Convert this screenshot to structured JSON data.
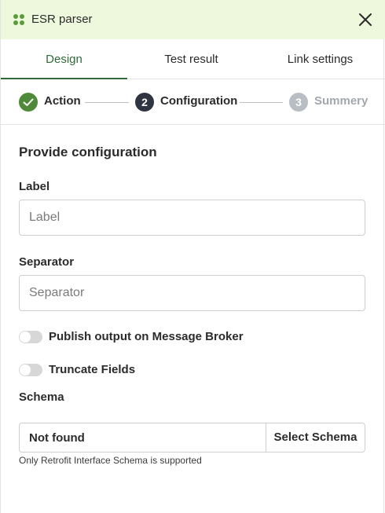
{
  "header": {
    "title": "ESR parser",
    "accent": "#5a9c3c",
    "background": "#eef8dc"
  },
  "tabs": [
    {
      "label": "Design",
      "active": true
    },
    {
      "label": "Test result",
      "active": false
    },
    {
      "label": "Link settings",
      "active": false
    }
  ],
  "stepper": {
    "steps": [
      {
        "number": "1",
        "label": "Action",
        "state": "completed",
        "icon": "check-icon"
      },
      {
        "number": "2",
        "label": "Configuration",
        "state": "current"
      },
      {
        "number": "3",
        "label": "Summery",
        "state": "upcoming"
      }
    ]
  },
  "form": {
    "section_title": "Provide configuration",
    "label_field": {
      "label": "Label",
      "placeholder": "Label",
      "value": ""
    },
    "separator_field": {
      "label": "Separator",
      "placeholder": "Separator",
      "value": ""
    },
    "toggles": [
      {
        "label": "Publish output on Message Broker",
        "on": false
      },
      {
        "label": "Truncate Fields",
        "on": false
      }
    ],
    "schema": {
      "label": "Schema",
      "value": "Not found",
      "button_label": "Select Schema",
      "hint": "Only Retrofit Interface Schema is supported"
    }
  },
  "colors": {
    "tab_active": "#2f6b3a",
    "step_completed": "#4f8a3a",
    "step_current": "#2f3441",
    "step_upcoming": "#b9bec5"
  }
}
